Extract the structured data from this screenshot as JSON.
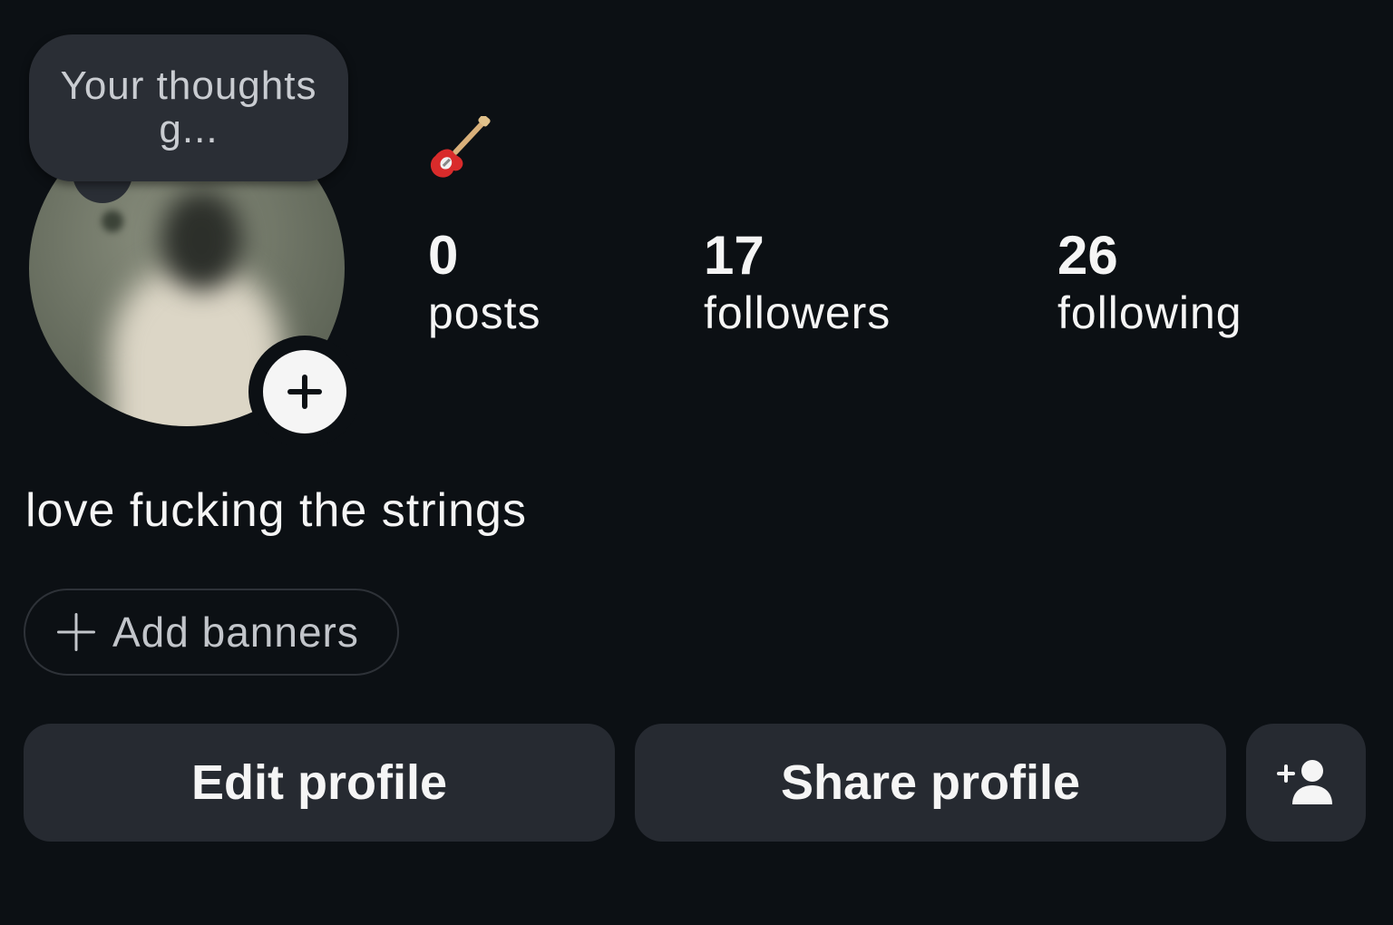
{
  "profile": {
    "note": "Your thoughts g...",
    "bio": "love fucking the strings",
    "pronoun_emoji": "guitar-emoji"
  },
  "stats": {
    "posts": {
      "value": "0",
      "label": "posts"
    },
    "followers": {
      "value": "17",
      "label": "followers"
    },
    "following": {
      "value": "26",
      "label": "following"
    }
  },
  "banners": {
    "add_label": "Add banners"
  },
  "actions": {
    "edit_label": "Edit profile",
    "share_label": "Share profile",
    "discover_icon": "add-person-icon"
  },
  "colors": {
    "background": "#0c1014",
    "button": "#262a31",
    "note_bubble": "#2a2e35",
    "text": "#f5f5f5"
  }
}
